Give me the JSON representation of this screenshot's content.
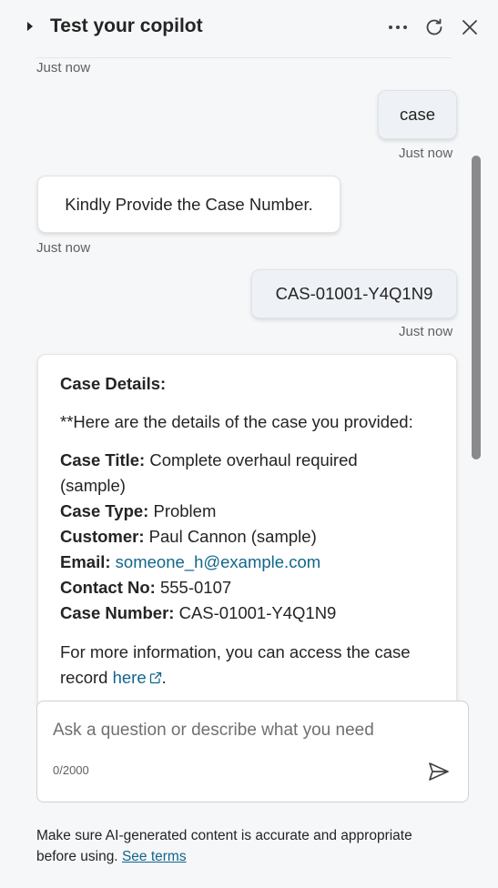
{
  "header": {
    "title": "Test your copilot",
    "icons": [
      "caret-right-icon",
      "more-icon",
      "refresh-icon",
      "close-icon"
    ]
  },
  "messages": [
    {
      "role": "timestamp",
      "text": "Just now"
    },
    {
      "role": "user",
      "text": "case",
      "time": "Just now"
    },
    {
      "role": "bot",
      "text": "Kindly Provide the Case Number.",
      "time": "Just now"
    },
    {
      "role": "user",
      "text": "CAS-01001-Y4Q1N9",
      "time": "Just now"
    }
  ],
  "case_card": {
    "heading": "Case Details:",
    "intro": "**Here are the details of the case you provided:",
    "title_label": "Case Title:",
    "title_value_1": " Complete overhaul required",
    "title_value_2": "(sample)",
    "type_label": "Case Type:",
    "type_value": " Problem",
    "customer_label": "Customer:",
    "customer_value": " Paul Cannon (sample)",
    "email_label": "Email:",
    "email_value": "someone_h@example.com",
    "contact_label": "Contact No:",
    "contact_value": " 555-0107",
    "number_label": "Case Number:",
    "number_value": " CAS-01001-Y4Q1N9",
    "more_info_1": "For more information, you can access the case",
    "more_info_2": "record ",
    "here_link": "here",
    "period": "."
  },
  "composer": {
    "placeholder": "Ask a question or describe what you need",
    "counter": "0/2000"
  },
  "disclaimer": {
    "line1": "Make sure AI-generated content is accurate and appropriate",
    "line2": "before using. ",
    "terms_link": "See terms"
  },
  "colors": {
    "link": "#11668c",
    "user_bubble": "#eef2f6",
    "background": "#f6f7f8"
  }
}
